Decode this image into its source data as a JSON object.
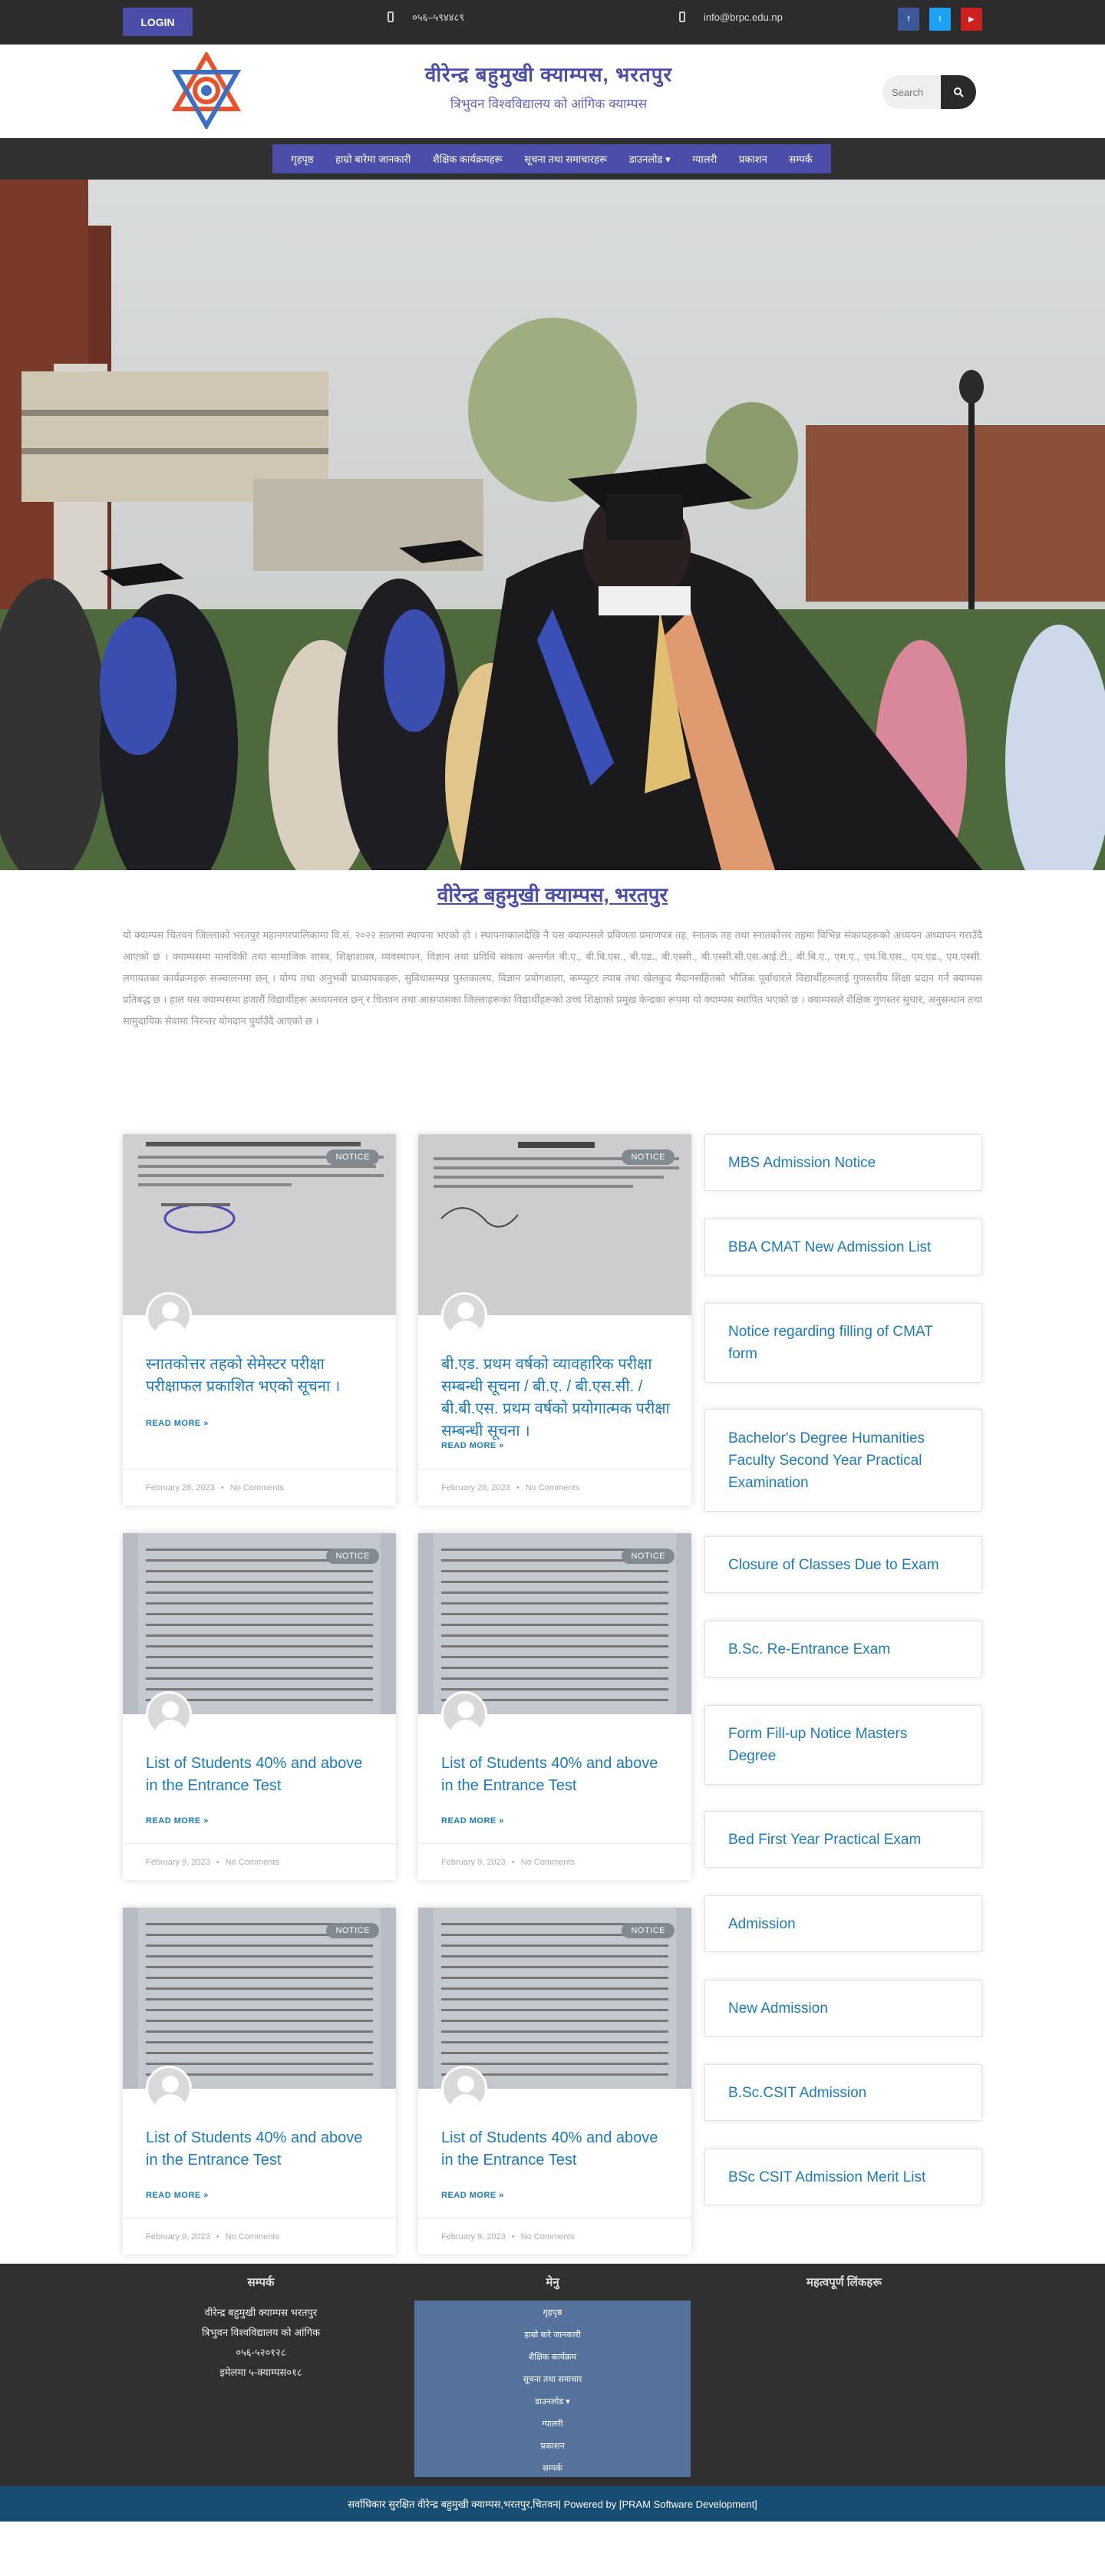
{
  "topbar": {
    "login_label": "LOGIN",
    "phone": "०५६–५९४४८९",
    "email": "info@brpc.edu.np",
    "social": {
      "facebook_icon": "facebook-icon",
      "twitter_icon": "twitter-icon",
      "youtube_icon": "youtube-icon",
      "facebook_color": "#3b5998",
      "twitter_color": "#1da1f2",
      "youtube_color": "#cd201f"
    }
  },
  "header": {
    "title": "वीरेन्द्र बहुमुखी क्याम्पस, भरतपुर",
    "subtitle": "त्रिभुवन विश्वविद्यालय को आंगिक क्याम्पस",
    "search_placeholder": "Search",
    "accent_color": "#4b4ea8"
  },
  "nav": {
    "items": [
      {
        "label": "गृहपृष्ठ"
      },
      {
        "label": "हाम्रो बारेमा जानकारी"
      },
      {
        "label": "शैक्षिक कार्यक्रमहरू"
      },
      {
        "label": "सूचना तथा समाचारहरू"
      },
      {
        "label": "डाउनलोड ▾"
      },
      {
        "label": "ग्यालरी"
      },
      {
        "label": "प्रकाशन"
      },
      {
        "label": "सम्पर्क"
      }
    ]
  },
  "intro": {
    "title": "वीरेन्द्र बहुमुखी क्याम्पस, भरतपुर",
    "body": "यो क्याम्पस चितवन जिल्लाको भरतपुर महानगरपालिकामा वि.सं. २०२२ सालमा स्थापना भएको हो । स्थापनाकालदेखि नै यस क्याम्पसले प्रविणता प्रमाणपत्र तह, स्नातक तह तथा स्नातकोत्तर तहमा विभिन्न संकायहरूको अध्ययन अध्यापन गराउँदै आएको छ । क्याम्पसमा मानविकी तथा सामाजिक शास्त्र, शिक्षाशास्त्र, व्यवस्थापन, विज्ञान तथा प्रविधि संकाय अन्तर्गत बी.ए., बी.बि.एस., बी.एड., बी.एस्सी., बी.एस्सी.सी.एस.आई.टी., बी.बि.ए., एम.ए., एम.बि.एस., एम.एड., एम.एस्सी. लगायतका कार्यक्रमहरू सञ्चालनमा छन् । योग्य तथा अनुभवी प्राध्यापकहरू, सुविधासम्पन्न पुस्तकालय, विज्ञान प्रयोगशाला, कम्प्युटर ल्याब तथा खेलकुद मैदानसहितको भौतिक पूर्वाधारले विद्यार्थीहरूलाई गुणस्तरीय शिक्षा प्रदान गर्न क्याम्पस प्रतिबद्ध छ । हाल यस क्याम्पसमा हजारौं विद्यार्थीहरू अध्ययनरत छन् र चितवन तथा आसपासका जिल्लाहरूका विद्यार्थीहरूको उच्च शिक्षाको प्रमुख केन्द्रका रूपमा यो क्याम्पस स्थापित भएको छ । क्याम्पसले शैक्षिक गुणस्तर सुधार, अनुसन्धान तथा सामुदायिक सेवामा निरन्तर योगदान पुर्याउँदै आएको छ ।"
  },
  "posts": [
    {
      "title": "स्नातकोत्तर तहको सेमेस्टर परीक्षा परीक्षाफल प्रकाशित भएको सूचना ।",
      "read_more": "READ MORE »",
      "date": "February 28, 2023",
      "comments": "No Comments",
      "badge": "NOTICE"
    },
    {
      "title": "बी.एड. प्रथम वर्षको व्यावहारिक परीक्षा सम्बन्धी सूचना / बी.ए. / बी.एस.सी. / बी.बी.एस. प्रथम वर्षको प्रयोगात्मक परीक्षा सम्बन्धी सूचना ।",
      "read_more": "READ MORE »",
      "date": "February 28, 2023",
      "comments": "No Comments",
      "badge": "NOTICE"
    },
    {
      "title": "List of Students 40% and above in the Entrance Test",
      "read_more": "READ MORE »",
      "date": "February 9, 2023",
      "comments": "No Comments",
      "badge": "NOTICE"
    },
    {
      "title": "List of Students 40% and above in the Entrance Test",
      "read_more": "READ MORE »",
      "date": "February 9, 2023",
      "comments": "No Comments",
      "badge": "NOTICE"
    },
    {
      "title": "List of Students 40% and above in the Entrance Test",
      "read_more": "READ MORE »",
      "date": "February 9, 2023",
      "comments": "No Comments",
      "badge": "NOTICE"
    },
    {
      "title": "List of Students 40% and above in the Entrance Test",
      "read_more": "READ MORE »",
      "date": "February 9, 2023",
      "comments": "No Comments",
      "badge": "NOTICE"
    }
  ],
  "meta_separator": "•",
  "sidebar": {
    "items": [
      {
        "label": "MBS Admission Notice"
      },
      {
        "label": "BBA CMAT New Admission List"
      },
      {
        "label": "Notice regarding filling of CMAT form"
      },
      {
        "label": "Bachelor's Degree Humanities Faculty Second Year Practical Examination"
      },
      {
        "label": "Closure of Classes Due to Exam"
      },
      {
        "label": "B.Sc. Re-Entrance Exam"
      },
      {
        "label": "Form Fill-up Notice Masters Degree"
      },
      {
        "label": "Bed First Year Practical Exam"
      },
      {
        "label": "Admission"
      },
      {
        "label": "New Admission"
      },
      {
        "label": "B.Sc.CSIT Admission"
      },
      {
        "label": "BSc CSIT Admission Merit List"
      }
    ]
  },
  "footer": {
    "contact_heading": "सम्पर्क",
    "menu_heading": "मेनु",
    "links_heading": "महत्वपूर्ण लिंकहरू",
    "contact_lines": [
      "वीरेन्द्र बहुमुखी क्याम्पस भरतपुर",
      "त्रिभुवन विश्वविद्यालय को आंगिक",
      "०५६-५२०१२८",
      "इमेलमा ५-क्याम्पस०१८"
    ],
    "menu_items": [
      {
        "label": "गृहपृष्ठ"
      },
      {
        "label": "हाम्रो बारे जानकारी"
      },
      {
        "label": "शैक्षिक कार्यक्रम"
      },
      {
        "label": "सूचना तथा समाचार"
      },
      {
        "label": "डाउनलोड ▾"
      },
      {
        "label": "ग्यालरी"
      },
      {
        "label": "प्रकाशन"
      },
      {
        "label": "सम्पर्क"
      }
    ],
    "copyright": "सर्वाधिकार सुरक्षित वीरेन्द्र बहुमुखी क्याम्पस,भरतपुर,चितवन| Powered by [PRAM Software Development]"
  }
}
